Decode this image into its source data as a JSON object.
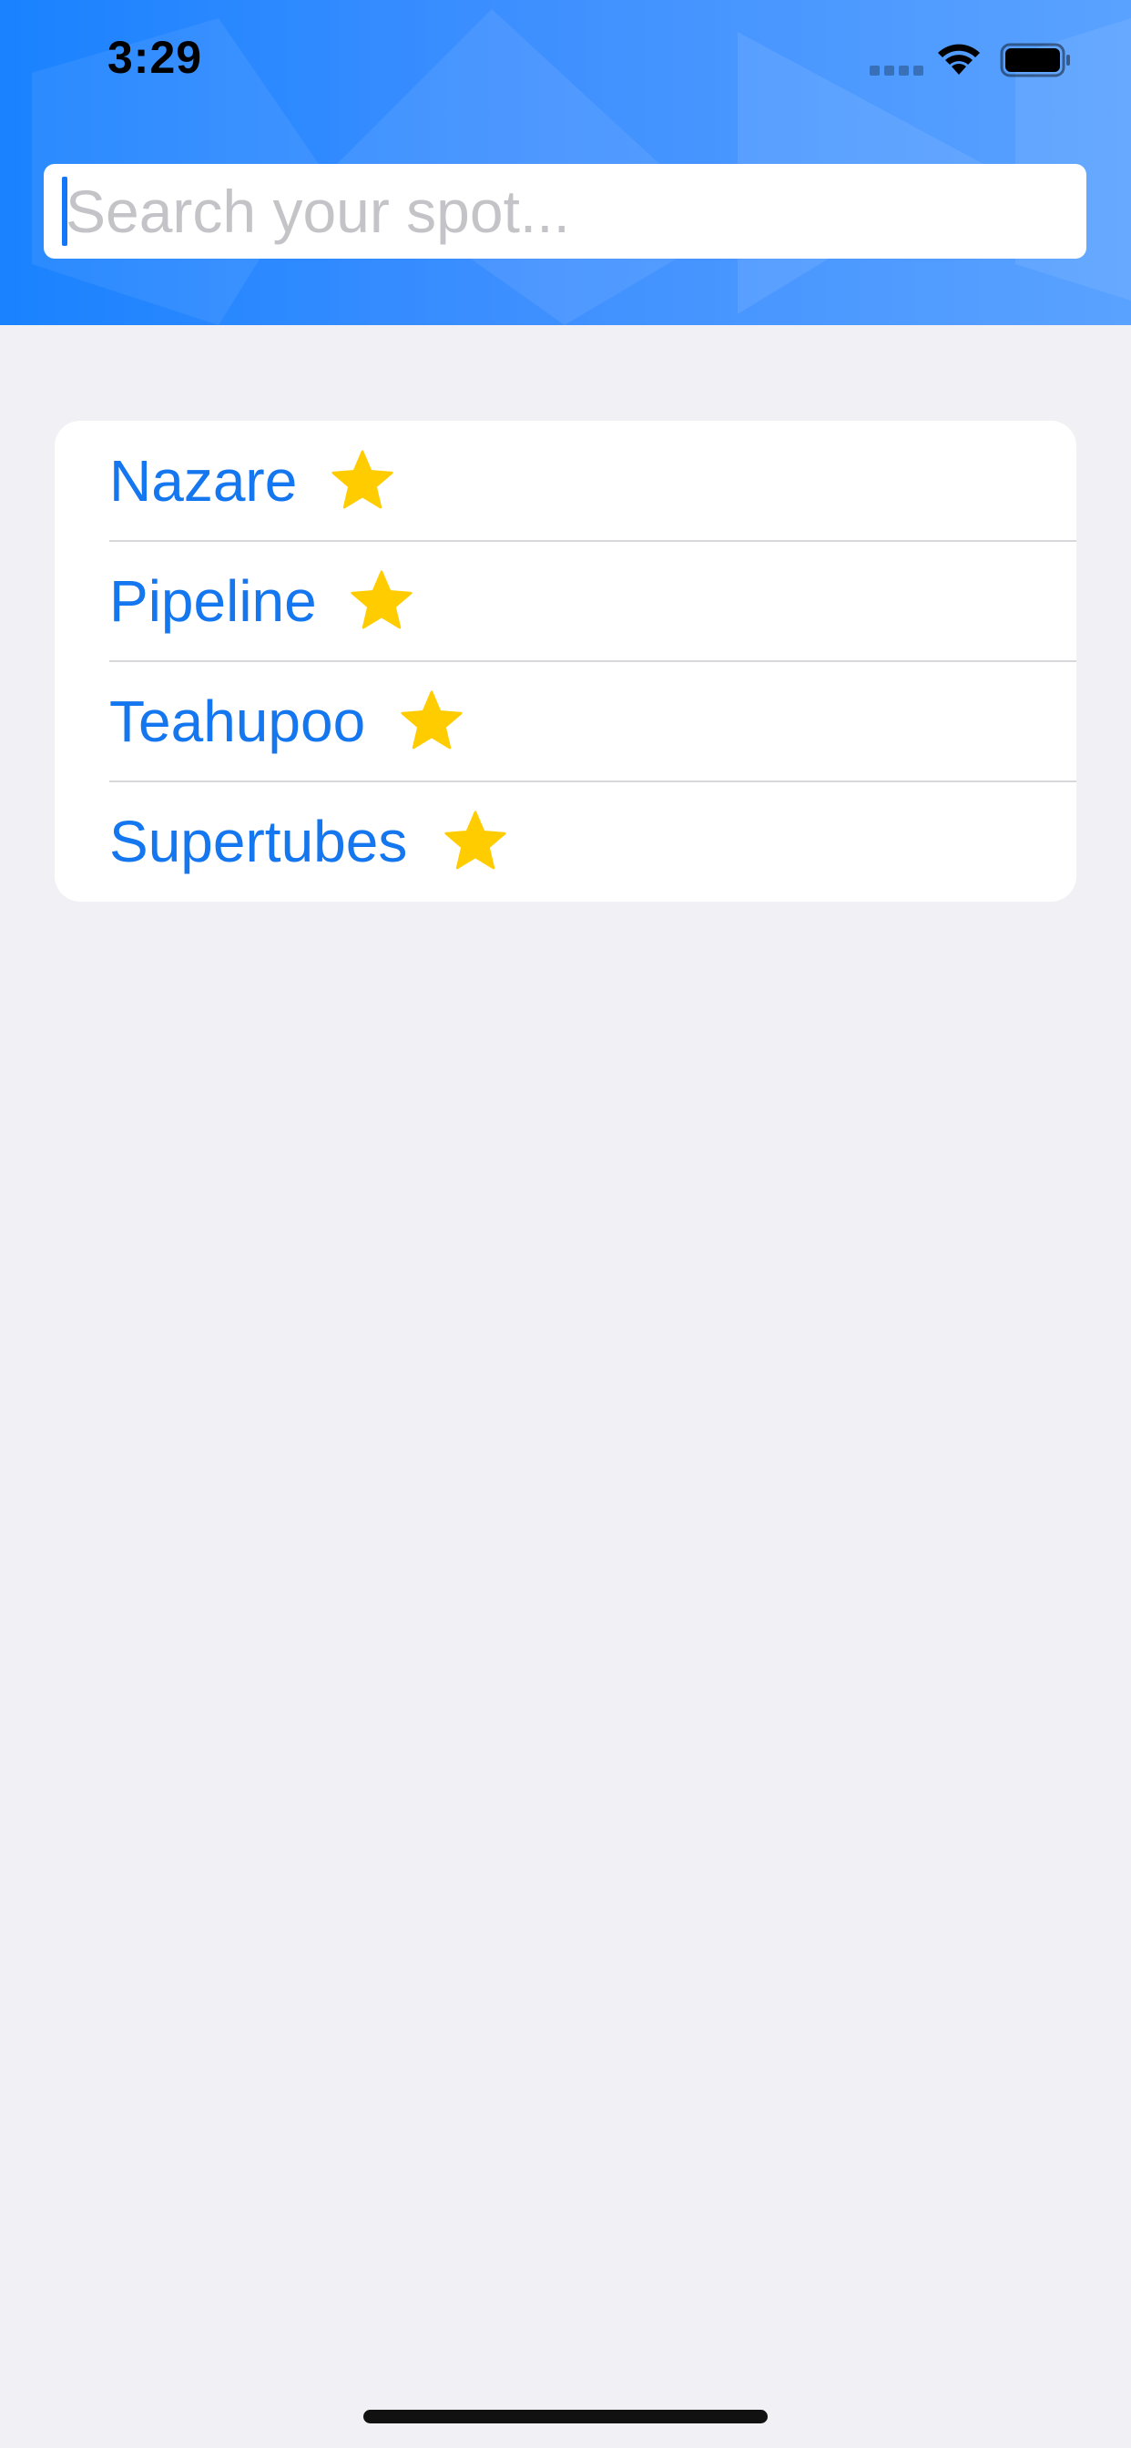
{
  "status_bar": {
    "time": "3:29"
  },
  "search": {
    "placeholder": "Search your spot...",
    "value": ""
  },
  "spots": [
    {
      "name": "Nazare",
      "icon": "star-icon",
      "favorite": true
    },
    {
      "name": "Pipeline",
      "icon": "star-icon",
      "favorite": true
    },
    {
      "name": "Teahupoo",
      "icon": "star-icon",
      "favorite": true
    },
    {
      "name": "Supertubes",
      "icon": "star-icon",
      "favorite": true
    }
  ],
  "colors": {
    "header_blue": "#1a82ff",
    "link_blue": "#1477f0",
    "star_yellow": "#ffcc00",
    "background": "#f0f0f5"
  }
}
